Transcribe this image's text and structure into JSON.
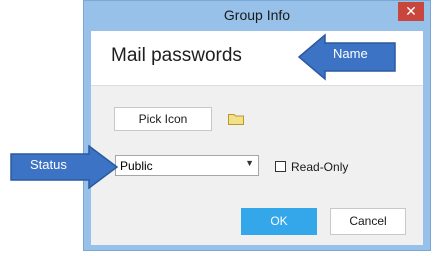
{
  "window": {
    "title": "Group Info",
    "close_glyph": "✕"
  },
  "group": {
    "name": "Mail passwords"
  },
  "icon_picker": {
    "button_label": "Pick Icon",
    "icon": "folder-icon"
  },
  "status": {
    "selected": "Public",
    "dropdown_icon": "chevron-down-icon"
  },
  "read_only": {
    "label": "Read-Only",
    "checked": false
  },
  "actions": {
    "ok_label": "OK",
    "cancel_label": "Cancel"
  },
  "callouts": {
    "name_label": "Name",
    "status_label": "Status"
  },
  "colors": {
    "window_frame": "#97c1e9",
    "close_button": "#c9463d",
    "ok_button": "#33a7ea",
    "callout_fill": "#3d73c5",
    "folder": "#f5e08a"
  }
}
